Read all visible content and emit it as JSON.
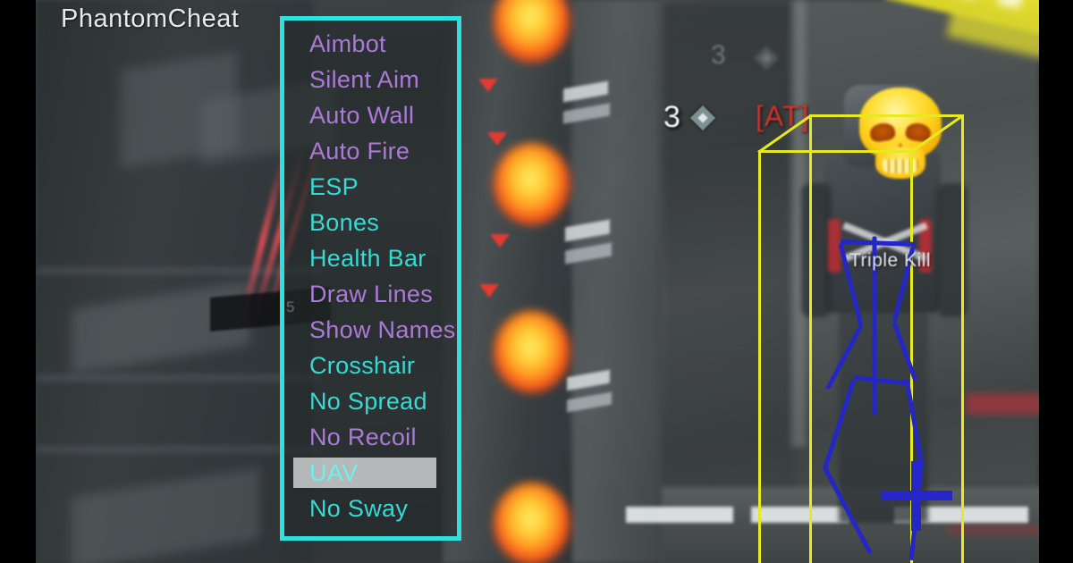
{
  "brand": {
    "title": "PhantomCheat"
  },
  "menu": {
    "accent_color": "#2fe0dc",
    "panel_bg": "rgba(36,42,42,0.62)",
    "color_enabled": "#35dbd2",
    "color_disabled": "#ab7ad6",
    "selected_index": 12,
    "items": [
      {
        "label": "Aimbot",
        "state": "off",
        "color": "#ab7ad6",
        "selected": false
      },
      {
        "label": "Silent Aim",
        "state": "off",
        "color": "#ab7ad6",
        "selected": false
      },
      {
        "label": "Auto Wall",
        "state": "off",
        "color": "#ab7ad6",
        "selected": false
      },
      {
        "label": "Auto Fire",
        "state": "off",
        "color": "#ab7ad6",
        "selected": false
      },
      {
        "label": "ESP",
        "state": "on",
        "color": "#35dbd2",
        "selected": false
      },
      {
        "label": "Bones",
        "state": "on",
        "color": "#35dbd2",
        "selected": false
      },
      {
        "label": "Health Bar",
        "state": "on",
        "color": "#35dbd2",
        "selected": false
      },
      {
        "label": "Draw Lines",
        "state": "off",
        "color": "#ab7ad6",
        "selected": false
      },
      {
        "label": "Show Names",
        "state": "off",
        "color": "#ab7ad6",
        "selected": false
      },
      {
        "label": "Crosshair",
        "state": "on",
        "color": "#35dbd2",
        "selected": false
      },
      {
        "label": "No Spread",
        "state": "on",
        "color": "#35dbd2",
        "selected": false
      },
      {
        "label": "No Recoil",
        "state": "off",
        "color": "#ab7ad6",
        "selected": false
      },
      {
        "label": "UAV",
        "state": "on",
        "color": "#6ff0ea",
        "selected": true
      },
      {
        "label": "No Sway",
        "state": "on",
        "color": "#35dbd2",
        "selected": false
      }
    ]
  },
  "hud": {
    "score": "3",
    "score_ghost": "3",
    "clan_tag": "[AT]",
    "killfeed": "Triple Kill",
    "ammo_counter": "5"
  },
  "esp": {
    "box_color": "#e8ea1f",
    "bone_color": "#2526c8",
    "crosshair_color": "#2526c8",
    "skull_color": "#ffd021"
  }
}
